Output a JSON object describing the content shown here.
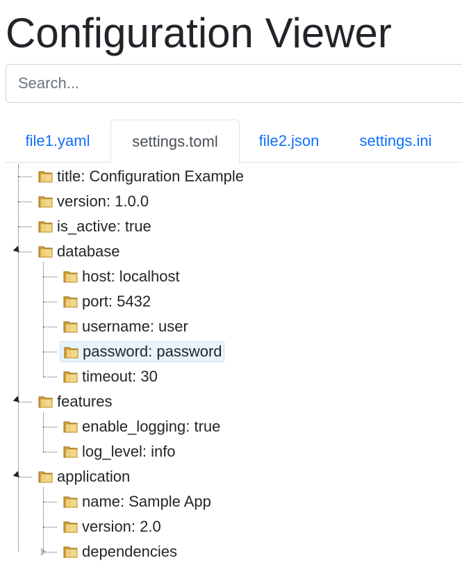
{
  "page": {
    "title": "Configuration Viewer"
  },
  "search": {
    "placeholder": "Search...",
    "value": ""
  },
  "tabs": [
    {
      "label": "file1.yaml",
      "active": false
    },
    {
      "label": "settings.toml",
      "active": true
    },
    {
      "label": "file2.json",
      "active": false
    },
    {
      "label": "settings.ini",
      "active": false
    }
  ],
  "tree": {
    "nodes": [
      {
        "label": "title: Configuration Example"
      },
      {
        "label": "version: 1.0.0"
      },
      {
        "label": "is_active: true"
      },
      {
        "label": "database",
        "expanded": true,
        "children": [
          {
            "label": "host: localhost"
          },
          {
            "label": "port: 5432"
          },
          {
            "label": "username: user"
          },
          {
            "label": "password: password",
            "selected": true
          },
          {
            "label": "timeout: 30"
          }
        ]
      },
      {
        "label": "features",
        "expanded": true,
        "children": [
          {
            "label": "enable_logging: true"
          },
          {
            "label": "log_level: info"
          }
        ]
      },
      {
        "label": "application",
        "expanded": true,
        "children": [
          {
            "label": "name: Sample App"
          },
          {
            "label": "version: 2.0"
          },
          {
            "label": "dependencies",
            "expanded": false
          }
        ]
      }
    ]
  },
  "colors": {
    "link": "#0d6efd",
    "selected_bg": "#e8f4fb",
    "folder": "#e8c26a"
  }
}
